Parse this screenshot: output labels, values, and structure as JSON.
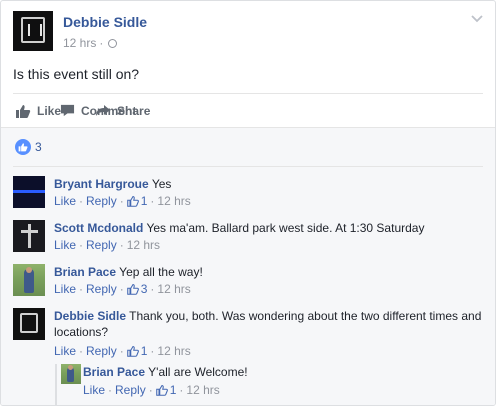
{
  "post": {
    "author": "Debbie Sidle",
    "time": "12 hrs",
    "separator": "·",
    "text": "Is this event still on?",
    "actions": {
      "like": "Like",
      "comment": "Comment",
      "share": "Share"
    },
    "reaction_count": "3"
  },
  "comments": [
    {
      "name": "Bryant Hargroue",
      "text": "Yes",
      "like": "Like",
      "reply": "Reply",
      "likes": "1",
      "time": "12 hrs"
    },
    {
      "name": "Scott Mcdonald",
      "text": "Yes ma'am. Ballard park west side. At 1:30 Saturday",
      "like": "Like",
      "reply": "Reply",
      "time": "12 hrs"
    },
    {
      "name": "Brian Pace",
      "text": "Yep all the way!",
      "like": "Like",
      "reply": "Reply",
      "likes": "3",
      "time": "12 hrs"
    },
    {
      "name": "Debbie Sidle",
      "text": "Thank you, both. Was wondering about the two different times and locations?",
      "like": "Like",
      "reply": "Reply",
      "likes": "1",
      "time": "12 hrs"
    },
    {
      "name": "Brian Pace",
      "text": "Y'all are Welcome!",
      "like": "Like",
      "reply": "Reply",
      "likes": "1",
      "time": "12 hrs"
    }
  ],
  "colors": {
    "link": "#365899",
    "muted": "#90949c",
    "accent": "#4267b2",
    "reaction": "#5890ff"
  },
  "icons": [
    "chevron-down-icon",
    "globe-icon",
    "thumbs-up-icon",
    "comment-icon",
    "share-icon",
    "like-reaction-icon"
  ]
}
